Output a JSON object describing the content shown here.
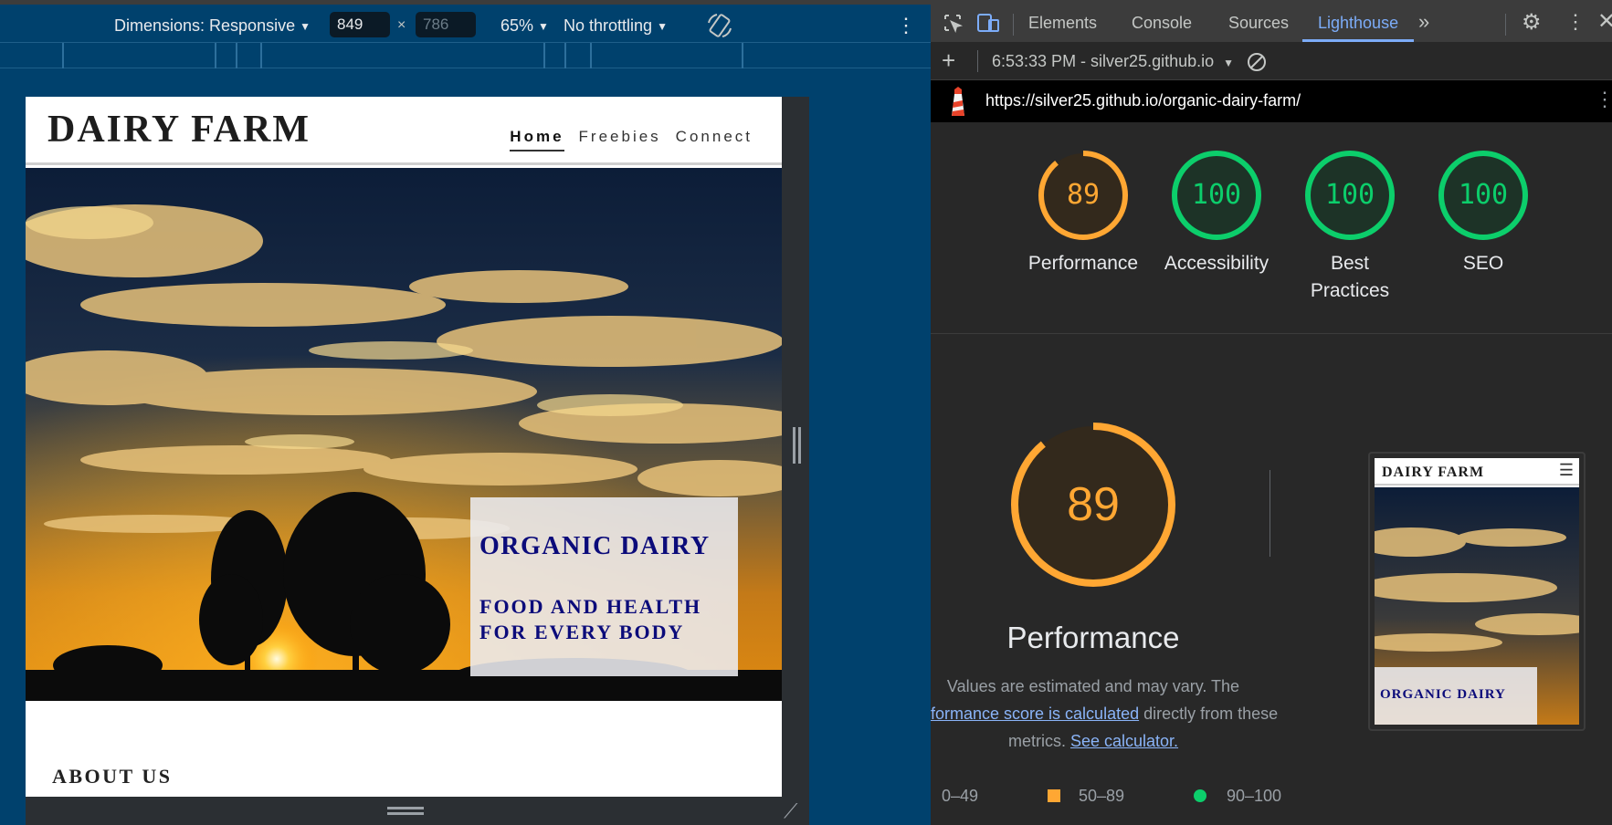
{
  "emulation": {
    "dimensions_label": "Dimensions: Responsive",
    "width": "849",
    "times": "×",
    "height_placeholder": "786",
    "zoom": "65%",
    "throttling": "No throttling"
  },
  "site": {
    "logo": "DAIRY FARM",
    "nav": [
      "Home",
      "Freebies",
      "Connect"
    ],
    "hero_heading": "ORGANIC DAIRY",
    "hero_line1": "FOOD AND HEALTH",
    "hero_line2": "FOR EVERY BODY",
    "about_heading": "ABOUT US"
  },
  "devtools": {
    "tabs": [
      "Elements",
      "Console",
      "Sources",
      "Lighthouse"
    ],
    "active_tab": "Lighthouse",
    "report_selector": "6:53:33 PM - silver25.github.io",
    "url": "https://silver25.github.io/organic-dairy-farm/"
  },
  "scores": [
    {
      "value": 89,
      "label_1": "Performance",
      "label_2": "",
      "color": "#ffa733"
    },
    {
      "value": 100,
      "label_1": "Accessibility",
      "label_2": "",
      "color": "#0cce6b"
    },
    {
      "value": 100,
      "label_1": "Best",
      "label_2": "Practices",
      "color": "#0cce6b"
    },
    {
      "value": 100,
      "label_1": "SEO",
      "label_2": "",
      "color": "#0cce6b"
    }
  ],
  "performance": {
    "score": 89,
    "title": "Performance",
    "desc_line1": "Values are estimated and may vary. The",
    "desc_link1": "formance score is calculated",
    "desc_line2_tail": " directly from these",
    "desc_line3_head": "metrics. ",
    "desc_link2": "See calculator.",
    "legend": [
      {
        "range": "0–49",
        "color": "#ff4e42"
      },
      {
        "range": "50–89",
        "color": "#ffa400"
      },
      {
        "range": "90–100",
        "color": "#0cce6b"
      }
    ]
  },
  "thumbnail": {
    "logo": "DAIRY FARM",
    "hero_heading": "ORGANIC DAIRY"
  },
  "icons": {
    "inspect": "inspect-element-icon",
    "device": "device-toolbar-icon",
    "rotate": "rotate-icon",
    "more_tabs": "chevron-double-right-icon",
    "settings": "gear-icon",
    "kebab": "kebab-menu-icon",
    "close": "close-icon",
    "add": "plus-icon",
    "clear": "clear-icon",
    "lighthouse": "lighthouse-icon",
    "hamburger": "hamburger-menu-icon"
  }
}
